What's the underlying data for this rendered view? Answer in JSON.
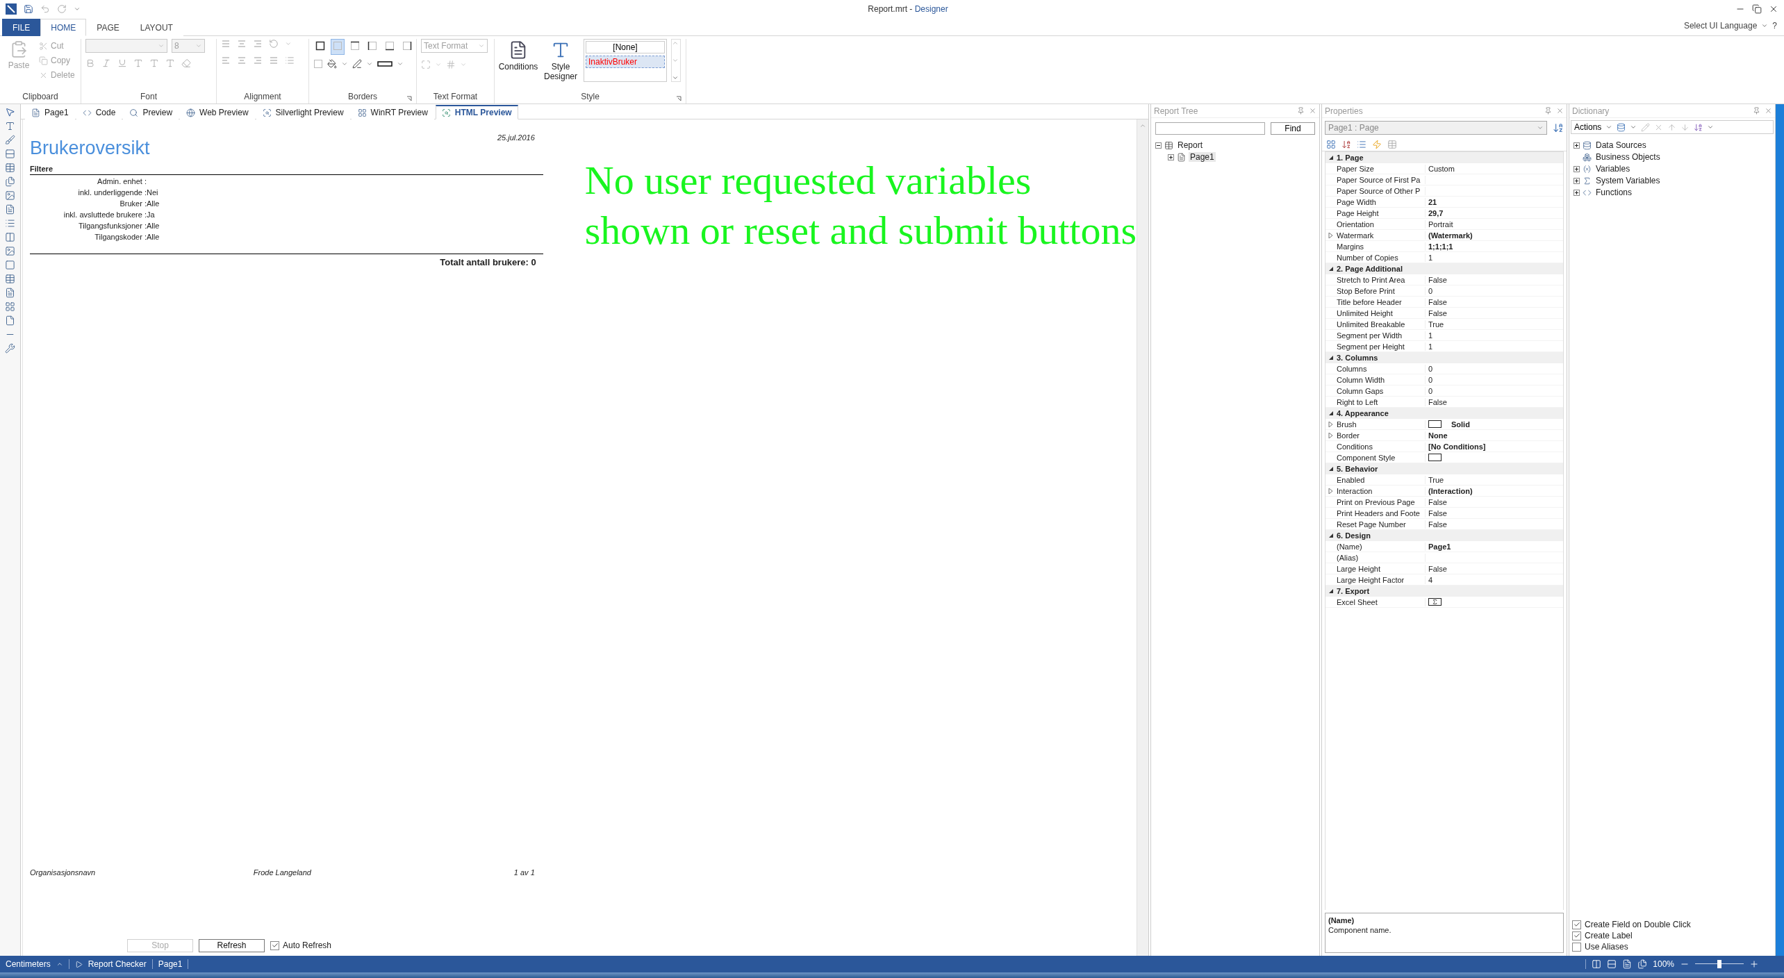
{
  "window": {
    "title": "Report.mrt -",
    "app": "Designer",
    "language_link": "Select UI Language",
    "help": "?"
  },
  "ribbon_tabs": [
    {
      "label": "FILE",
      "kind": "file",
      "selected": false
    },
    {
      "label": "HOME",
      "kind": "tab",
      "selected": true
    },
    {
      "label": "PAGE",
      "kind": "tab",
      "selected": false
    },
    {
      "label": "LAYOUT",
      "kind": "tab",
      "selected": false
    }
  ],
  "ribbon": {
    "groups": [
      {
        "title": "Clipboard",
        "kind": "clipboard",
        "launcher": false,
        "items": [
          {
            "label": "Paste",
            "disabled": true
          },
          {
            "label": "Cut",
            "disabled": true
          },
          {
            "label": "Copy",
            "disabled": true
          },
          {
            "label": "Delete",
            "disabled": true
          }
        ]
      },
      {
        "title": "Font",
        "kind": "font",
        "launcher": false,
        "size_value": "8"
      },
      {
        "title": "Alignment",
        "kind": "alignment",
        "launcher": false
      },
      {
        "title": "Borders",
        "kind": "borders",
        "launcher": true
      },
      {
        "title": "Text Format",
        "kind": "text_format",
        "launcher": false,
        "format_placeholder": "Text Format"
      },
      {
        "title": "Style",
        "kind": "style",
        "launcher": true,
        "buttons": [
          "Conditions",
          "Style Designer"
        ],
        "styles": [
          {
            "label": "[None]",
            "color": "#000000",
            "selected": false
          },
          {
            "label": "InaktivBruker",
            "color": "#ff0000",
            "selected": true
          }
        ]
      }
    ]
  },
  "doc_tabs": [
    {
      "label": "Page1",
      "selected": false
    },
    {
      "label": "Code",
      "selected": false
    },
    {
      "label": "Preview",
      "selected": false
    },
    {
      "label": "Web Preview",
      "selected": false
    },
    {
      "label": "Silverlight Preview",
      "selected": false
    },
    {
      "label": "WinRT Preview",
      "selected": false
    },
    {
      "label": "HTML Preview",
      "selected": true
    }
  ],
  "report": {
    "title": "Brukeroversikt",
    "date": "25.jul.2016",
    "section": "Filtere",
    "filters": [
      {
        "label": "Admin. enhet :"
      },
      {
        "label": "inkl. underliggende :",
        "value": "Nei"
      },
      {
        "label": "Bruker :",
        "value": "Alle"
      },
      {
        "label": "inkl. avsluttede brukere :",
        "value": "Ja"
      },
      {
        "label": "Tilgangsfunksjoner :",
        "value": "Alle"
      },
      {
        "label": "Tilgangskoder :",
        "value": "Alle"
      }
    ],
    "total": "Totalt antall brukere: 0",
    "footer": {
      "left": "Organisasjonsnavn",
      "center": "Frode Langeland",
      "right": "1 av 1"
    }
  },
  "annotation": {
    "lines": [
      "No user requested variables",
      "shown or reset and submit buttons"
    ]
  },
  "preview_controls": {
    "stop": {
      "label": "Stop",
      "disabled": true
    },
    "refresh": {
      "label": "Refresh",
      "disabled": false
    },
    "auto_refresh": {
      "label": "Auto Refresh",
      "checked": true
    }
  },
  "report_tree": {
    "title": "Report Tree",
    "find_button": "Find",
    "items": [
      {
        "label": "Report",
        "expanded": true,
        "selected": false,
        "children": [
          {
            "label": "Page1",
            "expanded": false,
            "selected": true
          }
        ]
      }
    ]
  },
  "properties": {
    "title": "Properties",
    "selector": "Page1 : Page",
    "categories": [
      {
        "title": "1. Page",
        "expanded": true,
        "rows": [
          {
            "name": "Paper Size",
            "kind": "text",
            "value": "Custom",
            "modified": false,
            "expandable": false
          },
          {
            "name": "Paper Source of First Pa",
            "kind": "text",
            "expandable": false
          },
          {
            "name": "Paper Source of Other P",
            "kind": "text",
            "expandable": false
          },
          {
            "name": "Page Width",
            "kind": "text",
            "value": "21",
            "modified": true,
            "expandable": false
          },
          {
            "name": "Page Height",
            "kind": "text",
            "value": "29,7",
            "modified": true,
            "expandable": false
          },
          {
            "name": "Orientation",
            "kind": "text",
            "value": "Portrait",
            "modified": false,
            "expandable": false
          },
          {
            "name": "Watermark",
            "kind": "text",
            "value": "(Watermark)",
            "modified": true,
            "expandable": true
          },
          {
            "name": "Margins",
            "kind": "text",
            "value": "1;1;1;1",
            "modified": true,
            "expandable": false
          },
          {
            "name": "Number of Copies",
            "kind": "text",
            "value": "1",
            "modified": false,
            "expandable": false
          }
        ]
      },
      {
        "title": "2. Page  Additional",
        "expanded": true,
        "rows": [
          {
            "name": "Stretch to Print Area",
            "kind": "text",
            "value": "False",
            "modified": false,
            "expandable": false
          },
          {
            "name": "Stop Before Print",
            "kind": "text",
            "value": "0",
            "modified": false,
            "expandable": false
          },
          {
            "name": "Title before Header",
            "kind": "text",
            "value": "False",
            "modified": false,
            "expandable": false
          },
          {
            "name": "Unlimited Height",
            "kind": "text",
            "value": "False",
            "modified": false,
            "expandable": false
          },
          {
            "name": "Unlimited Breakable",
            "kind": "text",
            "value": "True",
            "modified": false,
            "expandable": false
          },
          {
            "name": "Segment per Width",
            "kind": "text",
            "value": "1",
            "modified": false,
            "expandable": false
          },
          {
            "name": "Segment per Height",
            "kind": "text",
            "value": "1",
            "modified": false,
            "expandable": false
          }
        ]
      },
      {
        "title": "3. Columns",
        "expanded": true,
        "rows": [
          {
            "name": "Columns",
            "kind": "text",
            "value": "0",
            "modified": false,
            "expandable": false
          },
          {
            "name": "Column Width",
            "kind": "text",
            "value": "0",
            "modified": false,
            "expandable": false
          },
          {
            "name": "Column Gaps",
            "kind": "text",
            "value": "0",
            "modified": false,
            "expandable": false
          },
          {
            "name": "Right to Left",
            "kind": "text",
            "value": "False",
            "modified": false,
            "expandable": false
          }
        ]
      },
      {
        "title": "4. Appearance",
        "expanded": true,
        "rows": [
          {
            "name": "Brush",
            "kind": "swatch",
            "value": "Solid",
            "modified": true,
            "expandable": true
          },
          {
            "name": "Border",
            "kind": "text",
            "value": "None",
            "modified": true,
            "expandable": true
          },
          {
            "name": "Conditions",
            "kind": "text",
            "value": "[No Conditions]",
            "modified": true,
            "expandable": false
          },
          {
            "name": "Component Style",
            "kind": "swatch",
            "expandable": false
          }
        ]
      },
      {
        "title": "5. Behavior",
        "expanded": true,
        "rows": [
          {
            "name": "Enabled",
            "kind": "text",
            "value": "True",
            "modified": false,
            "expandable": false
          },
          {
            "name": "Interaction",
            "kind": "text",
            "value": "(Interaction)",
            "modified": true,
            "expandable": true
          },
          {
            "name": "Print on Previous Page",
            "kind": "text",
            "value": "False",
            "modified": false,
            "expandable": false
          },
          {
            "name": "Print Headers and Foote",
            "kind": "text",
            "value": "False",
            "modified": false,
            "expandable": false
          },
          {
            "name": "Reset Page Number",
            "kind": "text",
            "value": "False",
            "modified": false,
            "expandable": false
          }
        ]
      },
      {
        "title": "6. Design",
        "expanded": true,
        "rows": [
          {
            "name": "(Name)",
            "kind": "text",
            "value": "Page1",
            "modified": true,
            "expandable": false
          },
          {
            "name": "(Alias)",
            "kind": "text",
            "expandable": false
          },
          {
            "name": "Large Height",
            "kind": "text",
            "value": "False",
            "modified": false,
            "expandable": false
          },
          {
            "name": "Large Height Factor",
            "kind": "text",
            "value": "4",
            "modified": false,
            "expandable": false
          }
        ]
      },
      {
        "title": "7. Export",
        "expanded": true,
        "rows": [
          {
            "name": "Excel Sheet",
            "kind": "sigma",
            "expandable": false
          }
        ]
      }
    ],
    "description": {
      "title": "(Name)",
      "text": "Component name."
    }
  },
  "dictionary": {
    "title": "Dictionary",
    "actions": "Actions",
    "items": [
      {
        "label": "Data Sources",
        "kind": "datasource",
        "expandable": true
      },
      {
        "label": "Business Objects",
        "kind": "business",
        "expandable": false
      },
      {
        "label": "Variables",
        "kind": "variable",
        "expandable": true
      },
      {
        "label": "System Variables",
        "kind": "system",
        "expandable": true
      },
      {
        "label": "Functions",
        "kind": "function",
        "expandable": true
      }
    ],
    "options": [
      {
        "label": "Create Field on Double Click",
        "checked": true
      },
      {
        "label": "Create Label",
        "checked": true
      },
      {
        "label": "Use Aliases",
        "checked": false
      }
    ]
  },
  "status_bar": {
    "units": "Centimeters",
    "checker": "Report Checker",
    "page": "Page1",
    "zoom": "100%",
    "zoom_slider": {
      "level": 0.5
    }
  }
}
